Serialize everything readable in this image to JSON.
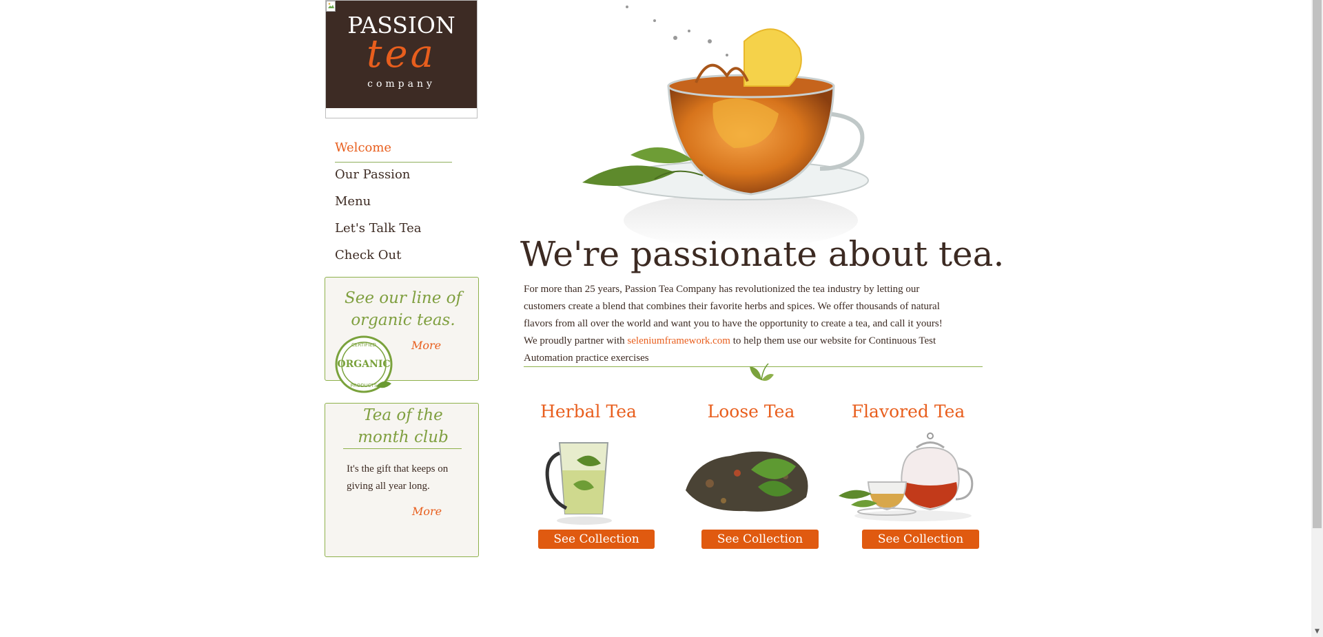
{
  "logo": {
    "line1": "PASSION",
    "line2": "tea",
    "line3": "company"
  },
  "nav": {
    "items": [
      {
        "label": "Welcome",
        "active": true
      },
      {
        "label": "Our Passion",
        "active": false
      },
      {
        "label": "Menu",
        "active": false
      },
      {
        "label": "Let's Talk Tea",
        "active": false
      },
      {
        "label": "Check Out",
        "active": false
      }
    ]
  },
  "organic_box": {
    "line1": "See our line of",
    "line2": "organic teas.",
    "more": "More",
    "seal_top": "CERTIFIED",
    "seal_center": "ORGANIC",
    "seal_bottom": "PRODUCTS"
  },
  "club_box": {
    "title_line1": "Tea of the",
    "title_line2": "month club",
    "body_line1": "It's the gift that keeps on",
    "body_line2": "giving all year long.",
    "more": "More"
  },
  "main": {
    "headline": "We're passionate about tea.",
    "intro_before": "For more than 25 years, Passion Tea Company has revolutionized the tea industry by letting our customers create a blend that combines their favorite herbs and spices. We offer thousands of natural flavors from all over the world and want you to have the opportunity to create a tea, and call it yours! We proudly partner with ",
    "intro_link": "seleniumframework.com",
    "intro_after": " to help them use our website for Continuous Test Automation practice exercises"
  },
  "products": [
    {
      "title": "Herbal Tea",
      "button": "See Collection"
    },
    {
      "title": "Loose Tea",
      "button": "See Collection"
    },
    {
      "title": "Flavored Tea",
      "button": "See Collection"
    }
  ],
  "colors": {
    "brown": "#3d2b24",
    "orange": "#e85e1d",
    "green": "#8db04a",
    "button": "#e05a10"
  },
  "icons": [
    "broken-image-icon",
    "organic-seal-icon",
    "leaf-icon",
    "scroll-down-arrow-icon"
  ]
}
